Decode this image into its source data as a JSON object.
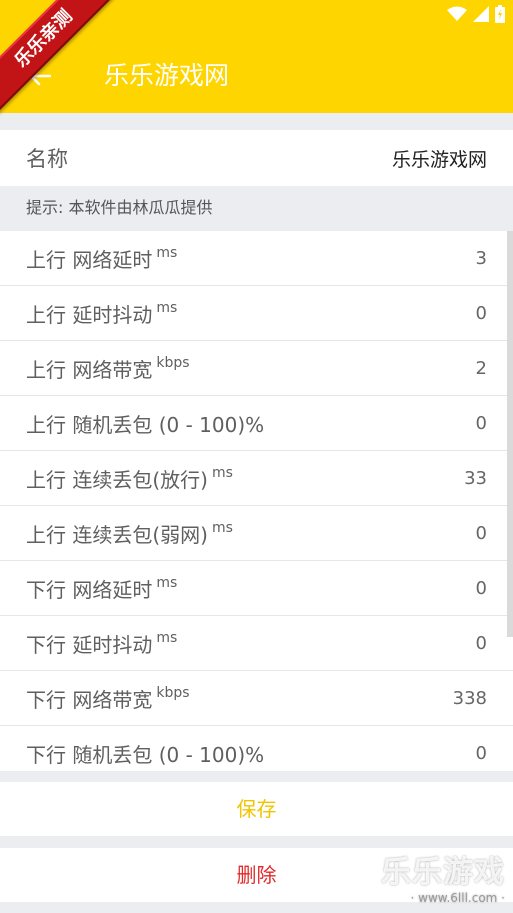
{
  "header": {
    "title": "乐乐游戏网",
    "ribbon": "乐乐亲测",
    "icons": [
      "wifi-icon",
      "signal-icon",
      "battery-icon",
      "arrow-left-icon"
    ],
    "color": "#ffd500"
  },
  "name_row": {
    "label": "名称",
    "value": "乐乐游戏网"
  },
  "hint": "提示: 本软件由林瓜瓜提供",
  "params": [
    {
      "label": "上行 网络延时",
      "unit": "ms",
      "value": "3"
    },
    {
      "label": "上行 延时抖动",
      "unit": "ms",
      "value": "0"
    },
    {
      "label": "上行 网络带宽",
      "unit": "kbps",
      "value": "2"
    },
    {
      "label": "上行 随机丢包 (0 - 100)%",
      "unit": "",
      "value": "0"
    },
    {
      "label": "上行 连续丢包(放行)",
      "unit": "ms",
      "value": "33"
    },
    {
      "label": "上行 连续丢包(弱网)",
      "unit": "ms",
      "value": "0"
    },
    {
      "label": "下行 网络延时",
      "unit": "ms",
      "value": "0"
    },
    {
      "label": "下行 延时抖动",
      "unit": "ms",
      "value": "0"
    },
    {
      "label": "下行 网络带宽",
      "unit": "kbps",
      "value": "338"
    },
    {
      "label": "下行 随机丢包 (0 - 100)%",
      "unit": "",
      "value": "0"
    }
  ],
  "buttons": {
    "save": "保存",
    "delete": "删除"
  },
  "watermark": {
    "big": "乐乐游戏",
    "small": "· www.6lll.com ·"
  },
  "colors": {
    "save": "#f1c500",
    "delete": "#e12a2a"
  }
}
